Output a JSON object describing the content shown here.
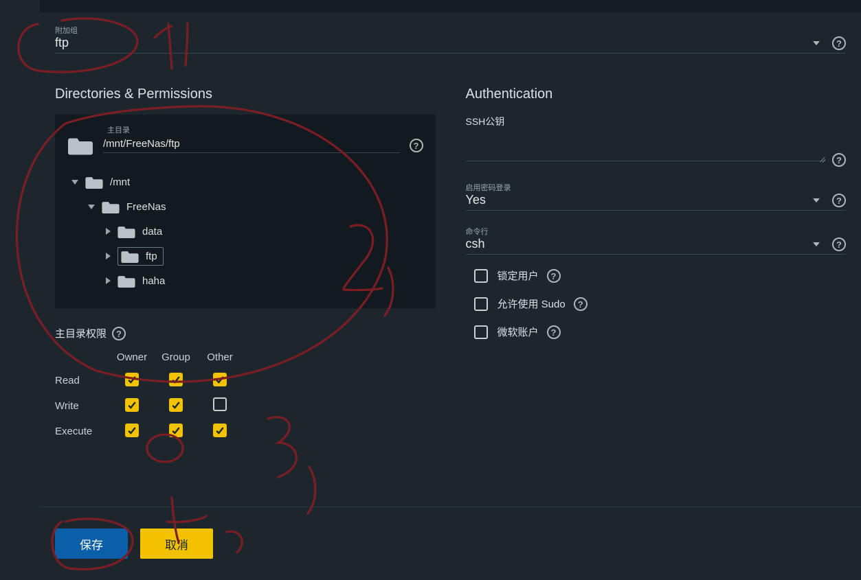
{
  "aux_group": {
    "label": "附加组",
    "value": "ftp"
  },
  "sections": {
    "dir_perm_title": "Directories & Permissions",
    "auth_title": "Authentication"
  },
  "home_dir": {
    "label": "主目录",
    "path": "/mnt/FreeNas/ftp"
  },
  "tree": {
    "root": "/mnt",
    "child": "FreeNas",
    "grand": [
      "data",
      "ftp",
      "haha"
    ],
    "selected_index": 1
  },
  "permissions": {
    "title": "主目录权限",
    "cols": [
      "Owner",
      "Group",
      "Other"
    ],
    "rows": [
      {
        "label": "Read",
        "vals": [
          true,
          true,
          true
        ]
      },
      {
        "label": "Write",
        "vals": [
          true,
          true,
          false
        ]
      },
      {
        "label": "Execute",
        "vals": [
          true,
          true,
          true
        ]
      }
    ]
  },
  "auth": {
    "ssh_label": "SSH公钥",
    "pwd_login": {
      "label": "启用密码登录",
      "value": "Yes"
    },
    "shell": {
      "label": "命令行",
      "value": "csh"
    },
    "checks": [
      {
        "label": "锁定用户",
        "checked": false
      },
      {
        "label": "允许使用 Sudo",
        "checked": false
      },
      {
        "label": "微软账户",
        "checked": false
      }
    ]
  },
  "buttons": {
    "save": "保存",
    "cancel": "取消"
  },
  "glyphs": {
    "question": "?"
  }
}
